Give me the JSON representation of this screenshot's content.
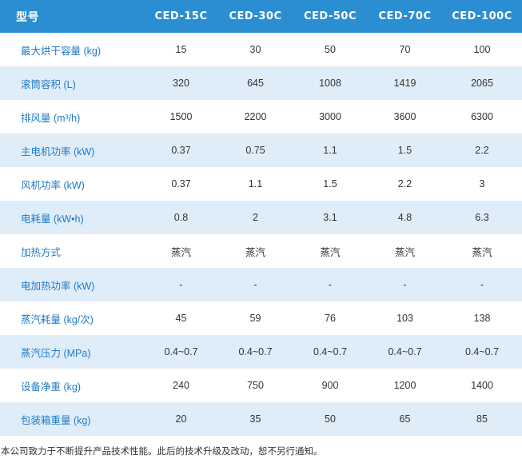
{
  "table": {
    "headers": [
      "型号",
      "CED-15C",
      "CED-30C",
      "CED-50C",
      "CED-70C",
      "CED-100C"
    ],
    "rows": [
      {
        "label": "最大烘干容量 (kg)",
        "values": [
          "15",
          "30",
          "50",
          "70",
          "100"
        ]
      },
      {
        "label": "滚筒容积 (L)",
        "values": [
          "320",
          "645",
          "1008",
          "1419",
          "2065"
        ]
      },
      {
        "label": "排风量 (m³/h)",
        "values": [
          "1500",
          "2200",
          "3000",
          "3600",
          "6300"
        ]
      },
      {
        "label": "主电机功率 (kW)",
        "values": [
          "0.37",
          "0.75",
          "1.1",
          "1.5",
          "2.2"
        ]
      },
      {
        "label": "风机功率 (kW)",
        "values": [
          "0.37",
          "1.1",
          "1.5",
          "2.2",
          "3"
        ]
      },
      {
        "label": "电耗量 (kW•h)",
        "values": [
          "0.8",
          "2",
          "3.1",
          "4.8",
          "6.3"
        ]
      },
      {
        "label": "加热方式",
        "values": [
          "蒸汽",
          "蒸汽",
          "蒸汽",
          "蒸汽",
          "蒸汽"
        ]
      },
      {
        "label": "电加热功率 (kW)",
        "values": [
          "-",
          "-",
          "-",
          "-",
          "-"
        ]
      },
      {
        "label": "蒸汽耗量 (kg/次)",
        "values": [
          "45",
          "59",
          "76",
          "103",
          "138"
        ]
      },
      {
        "label": "蒸汽压力 (MPa)",
        "values": [
          "0.4~0.7",
          "0.4~0.7",
          "0.4~0.7",
          "0.4~0.7",
          "0.4~0.7"
        ]
      },
      {
        "label": "设备净重 (kg)",
        "values": [
          "240",
          "750",
          "900",
          "1200",
          "1400"
        ]
      },
      {
        "label": "包装箱重量 (kg)",
        "values": [
          "20",
          "35",
          "50",
          "65",
          "85"
        ]
      }
    ]
  },
  "footnote": "本公司致力于不断提升产品技术性能。此后的技术升级及改动，恕不另行通知。",
  "colors": {
    "header_bg": "#2b8ed3",
    "stripe_bg": "#dfedf9",
    "label_text": "#1f79c5"
  }
}
